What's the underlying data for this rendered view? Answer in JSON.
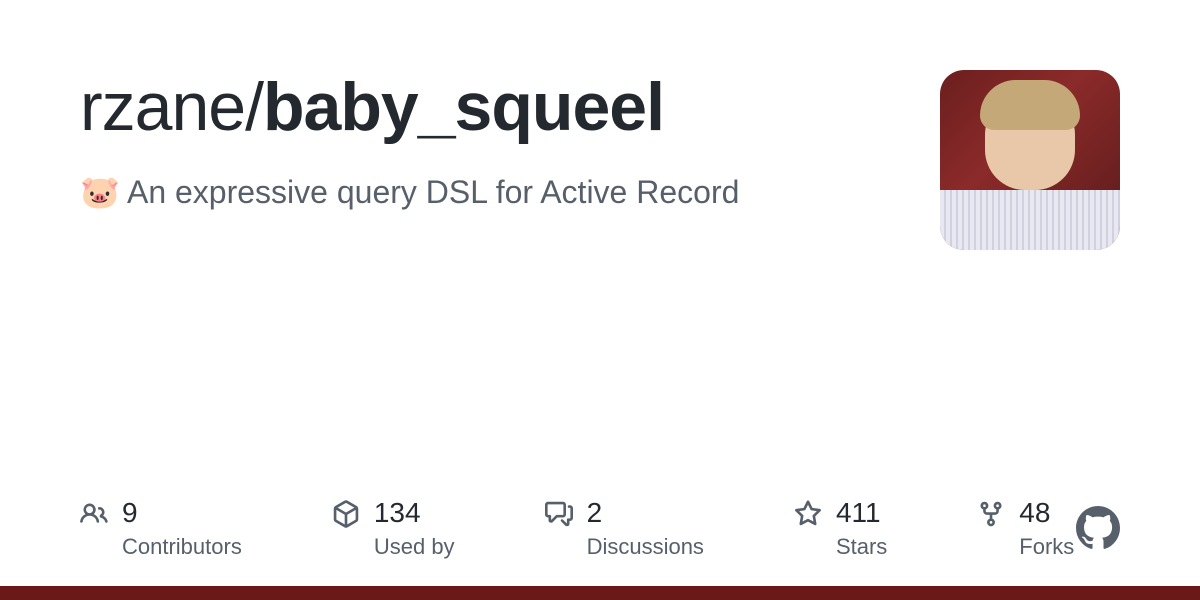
{
  "repo": {
    "owner": "rzane",
    "name": "baby_squeel",
    "description": "🐷 An expressive query DSL for Active Record"
  },
  "stats": {
    "contributors": {
      "value": "9",
      "label": "Contributors"
    },
    "used_by": {
      "value": "134",
      "label": "Used by"
    },
    "discussions": {
      "value": "2",
      "label": "Discussions"
    },
    "stars": {
      "value": "411",
      "label": "Stars"
    },
    "forks": {
      "value": "48",
      "label": "Forks"
    }
  },
  "accent_color": "#6a1818"
}
